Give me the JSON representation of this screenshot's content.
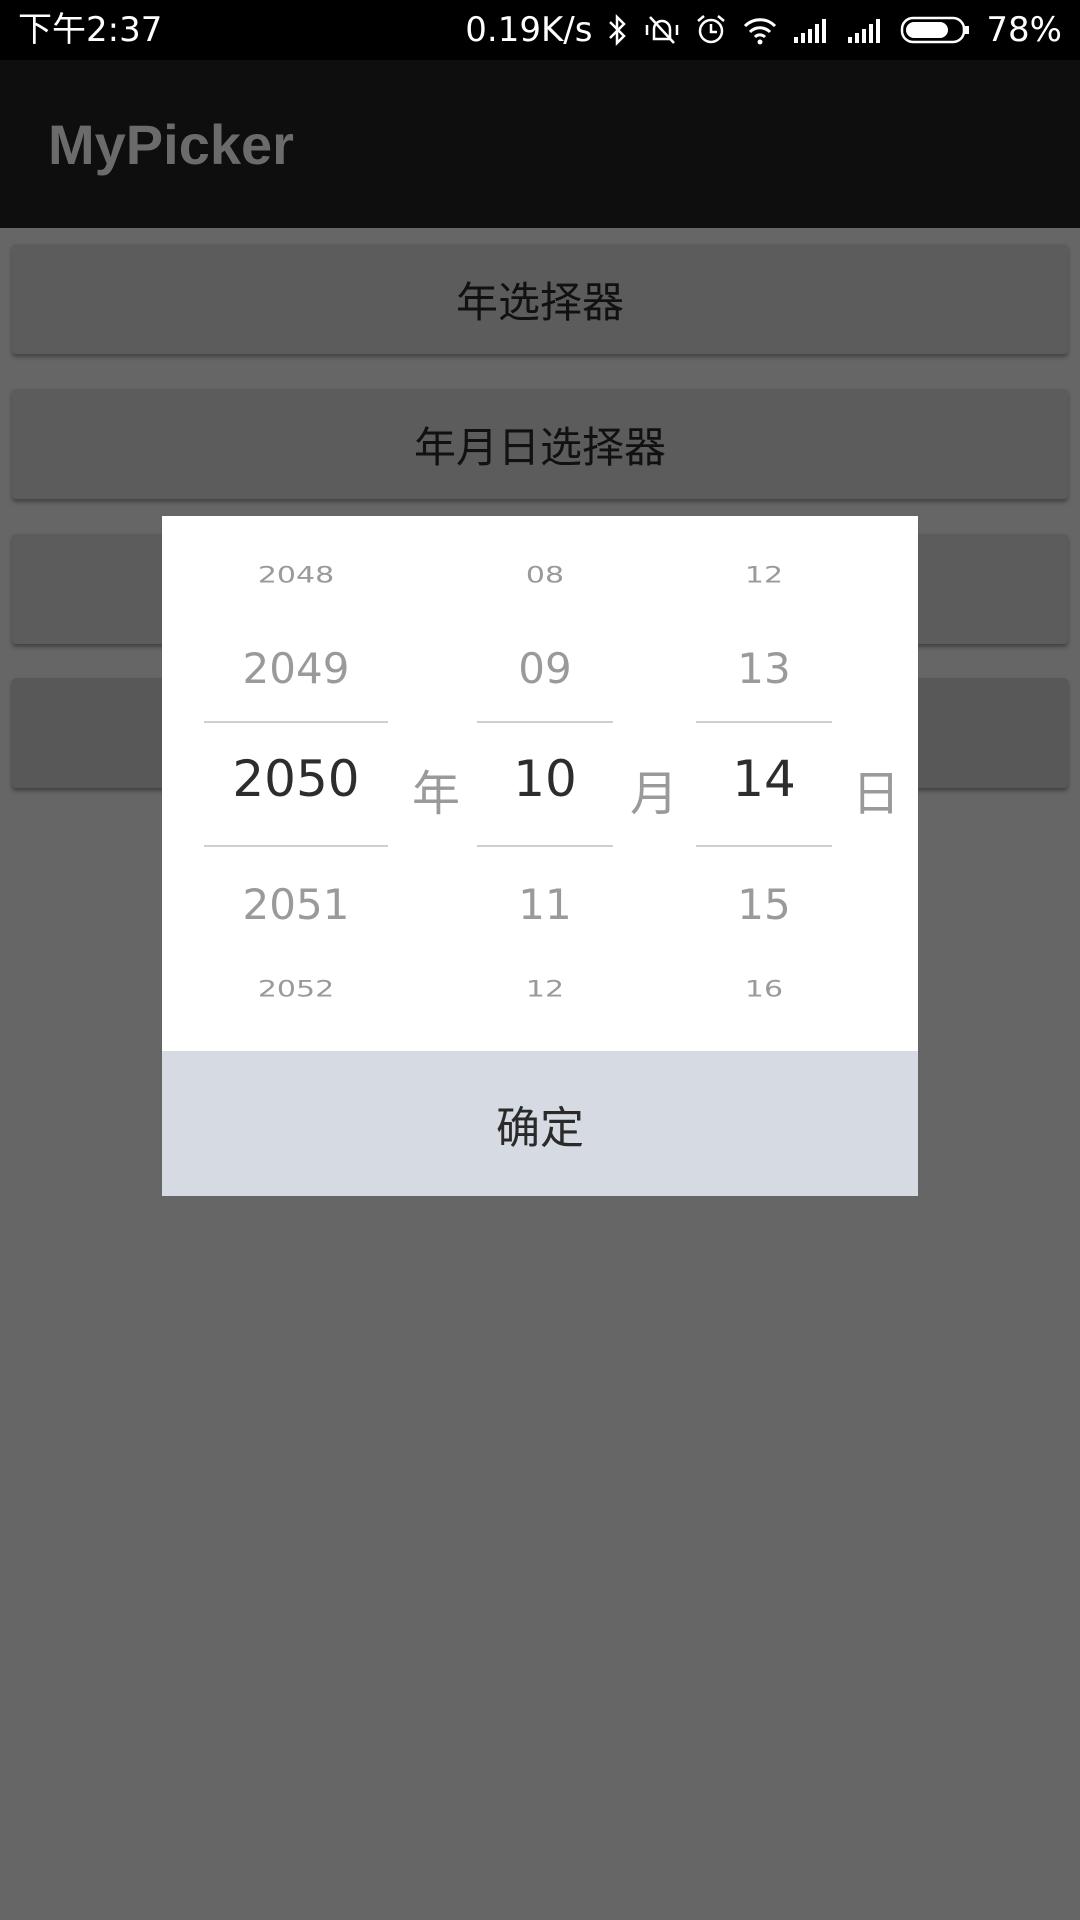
{
  "status_bar": {
    "time": "下午2:37",
    "network_speed": "0.19K/s",
    "battery_percent": "78%",
    "battery_level": 0.78,
    "icons": [
      "bluetooth-icon",
      "vibrate-off-icon",
      "alarm-icon",
      "wifi-icon",
      "signal-icon",
      "signal-icon",
      "battery-icon"
    ]
  },
  "app_bar": {
    "title": "MyPicker"
  },
  "background_buttons": [
    {
      "label": "年选择器"
    },
    {
      "label": "年月日选择器"
    }
  ],
  "picker": {
    "year": {
      "items": [
        "2048",
        "2049",
        "2050",
        "2051",
        "2052"
      ],
      "selected": "2050",
      "unit": "年"
    },
    "month": {
      "items": [
        "08",
        "09",
        "10",
        "11",
        "12"
      ],
      "selected": "10",
      "unit": "月"
    },
    "day": {
      "items": [
        "12",
        "13",
        "14",
        "15",
        "16"
      ],
      "selected": "14",
      "unit": "日"
    },
    "confirm_label": "确定"
  }
}
